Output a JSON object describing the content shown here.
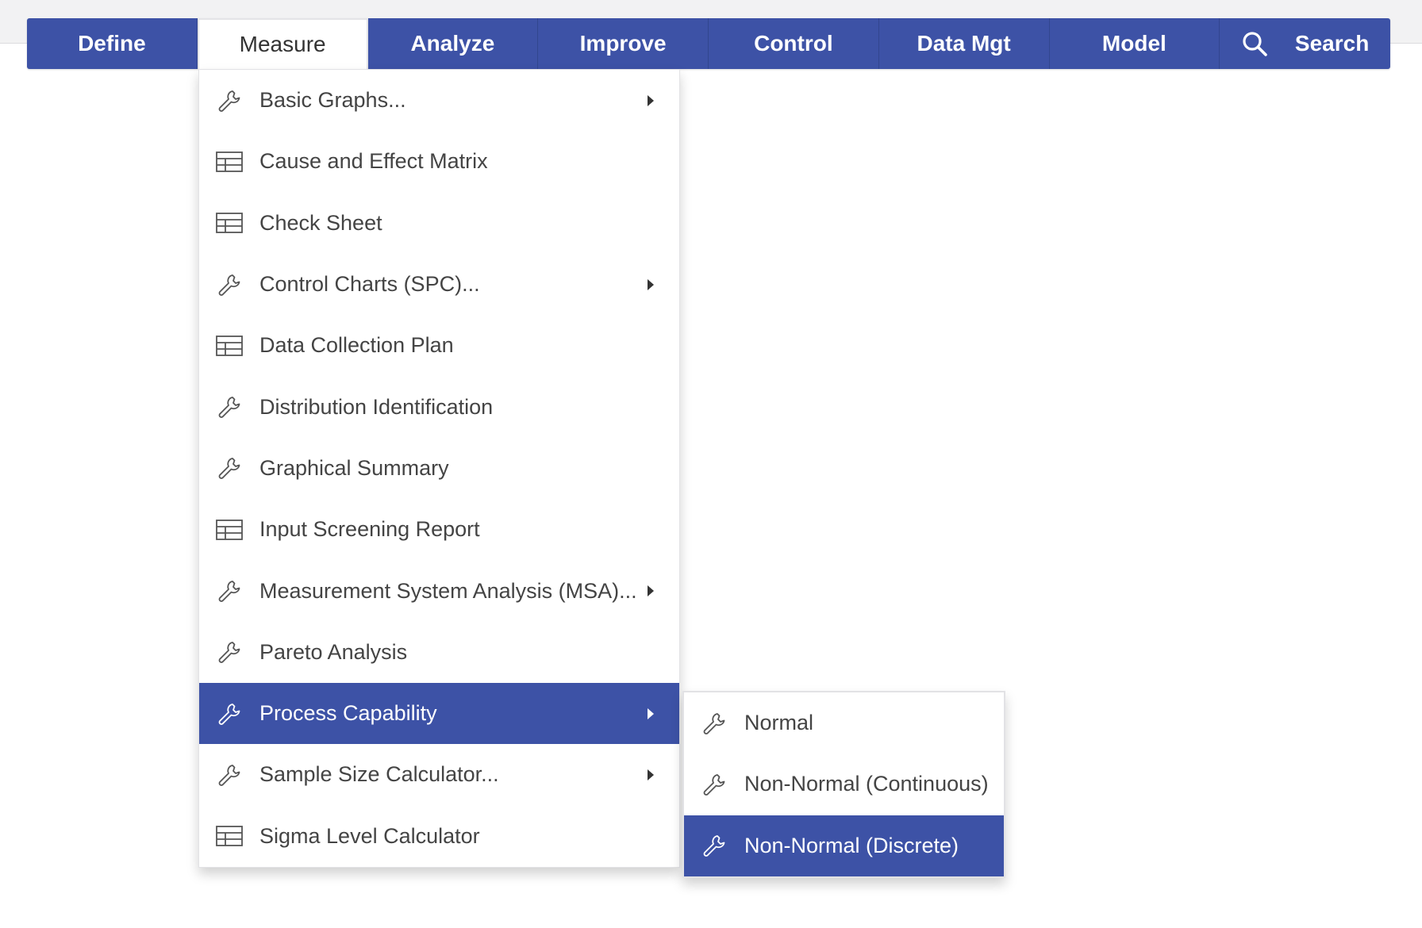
{
  "colors": {
    "primary": "#3d52a6",
    "menu_text": "#444444",
    "highlight_text": "#ffffff"
  },
  "nav": {
    "items": [
      {
        "label": "Define"
      },
      {
        "label": "Measure"
      },
      {
        "label": "Analyze"
      },
      {
        "label": "Improve"
      },
      {
        "label": "Control"
      },
      {
        "label": "Data Mgt"
      },
      {
        "label": "Model"
      }
    ],
    "active": "Measure",
    "search_icon": "search-icon",
    "search_label": "Search"
  },
  "measure_menu": {
    "items": [
      {
        "label": "Basic Graphs...",
        "icon": "wrench-icon",
        "has_submenu": true
      },
      {
        "label": "Cause and Effect Matrix",
        "icon": "table-icon",
        "has_submenu": false
      },
      {
        "label": "Check Sheet",
        "icon": "table-icon",
        "has_submenu": false
      },
      {
        "label": "Control Charts (SPC)...",
        "icon": "wrench-icon",
        "has_submenu": true
      },
      {
        "label": "Data Collection Plan",
        "icon": "table-icon",
        "has_submenu": false
      },
      {
        "label": "Distribution Identification",
        "icon": "wrench-icon",
        "has_submenu": false
      },
      {
        "label": "Graphical Summary",
        "icon": "wrench-icon",
        "has_submenu": false
      },
      {
        "label": "Input Screening Report",
        "icon": "table-icon",
        "has_submenu": false
      },
      {
        "label": "Measurement System Analysis (MSA)...",
        "icon": "wrench-icon",
        "has_submenu": true
      },
      {
        "label": "Pareto Analysis",
        "icon": "wrench-icon",
        "has_submenu": false
      },
      {
        "label": "Process Capability",
        "icon": "wrench-icon",
        "has_submenu": true,
        "highlighted": true
      },
      {
        "label": "Sample Size Calculator...",
        "icon": "wrench-icon",
        "has_submenu": true
      },
      {
        "label": "Sigma Level Calculator",
        "icon": "table-icon",
        "has_submenu": false
      }
    ]
  },
  "process_capability_submenu": {
    "items": [
      {
        "label": "Normal",
        "icon": "wrench-icon"
      },
      {
        "label": "Non-Normal (Continuous)",
        "icon": "wrench-icon"
      },
      {
        "label": "Non-Normal (Discrete)",
        "icon": "wrench-icon",
        "highlighted": true
      }
    ]
  }
}
